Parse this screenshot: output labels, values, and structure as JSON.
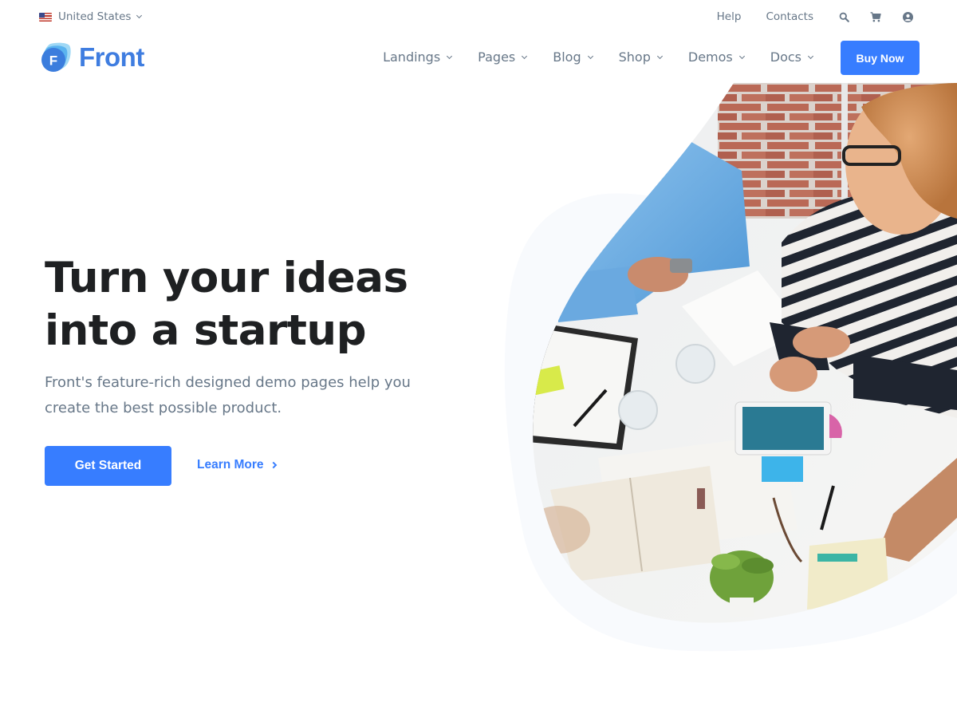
{
  "topbar": {
    "locale": {
      "label": "United States",
      "flag_icon": "us-flag-icon"
    },
    "links": [
      {
        "label": "Help"
      },
      {
        "label": "Contacts"
      }
    ],
    "icons": [
      "search-icon",
      "cart-icon",
      "user-circle-icon"
    ]
  },
  "navbar": {
    "logo": {
      "text": "Front",
      "mark_letter": "F"
    },
    "items": [
      {
        "label": "Landings"
      },
      {
        "label": "Pages"
      },
      {
        "label": "Blog"
      },
      {
        "label": "Shop"
      },
      {
        "label": "Demos"
      },
      {
        "label": "Docs"
      }
    ],
    "cta_label": "Buy Now"
  },
  "hero": {
    "title_line1": "Turn your ideas",
    "title_line2": "into a startup",
    "subtitle": "Front's feature-rich designed demo pages help you create the best possible product.",
    "primary_button": "Get Started",
    "secondary_link": "Learn More",
    "image_alt": "Team meeting around a table with documents, tablet and coffee"
  },
  "colors": {
    "primary": "#377dff",
    "logo": "#3f7de0",
    "heading": "#1e2022",
    "muted": "#677788",
    "blob_bg": "#f8fafd"
  }
}
